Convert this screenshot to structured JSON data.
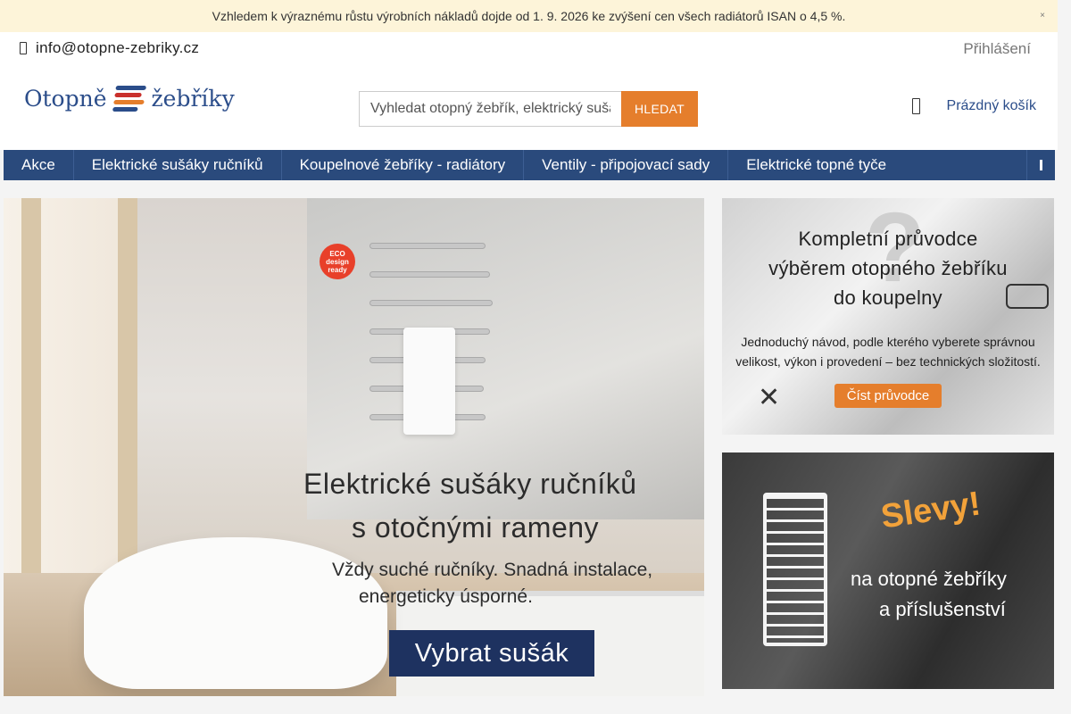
{
  "announcement": {
    "text": "Vzhledem k výraznému růstu výrobních nákladů dojde od 1. 9. 2026 ke zvýšení cen všech radiátorů ISAN o 4,5 %.",
    "close_icon": "×"
  },
  "topbar": {
    "email": "info@otopne-zebriky.cz",
    "login": "Přihlášení"
  },
  "header": {
    "logo_left": "Otopně",
    "logo_right": "žebříky",
    "search_placeholder": "Vyhledat otopný žebřík, elektrický sušák...",
    "search_button": "HLEDAT",
    "cart": "Prázdný košík"
  },
  "colors": {
    "accent": "#e57e2c",
    "nav_bg": "#2a4a7c",
    "brand_blue": "#2b4d8a"
  },
  "nav": {
    "items": [
      {
        "label": "Akce"
      },
      {
        "label": "Elektrické sušáky ručníků"
      },
      {
        "label": "Koupelnové žebříky - radiátory"
      },
      {
        "label": "Ventily - připojovací sady"
      },
      {
        "label": "Elektrické topné tyče"
      }
    ]
  },
  "hero": {
    "badge": "ECO design ready",
    "title_line1": "Elektrické sušáky ručníků",
    "title_line2": "s otočnými rameny",
    "text_line1": "Vždy suché ručníky. Snadná instalace,",
    "text_line2": "energeticky úsporné.",
    "cta": "Vybrat sušák"
  },
  "side_banner_guide": {
    "title_line1": "Kompletní průvodce",
    "title_line2": "výběrem otopného žebříku",
    "title_line3": "do koupelny",
    "text_line1": "Jednoduchý návod, podle kterého vyberete správnou",
    "text_line2": "velikost, výkon i provedení – bez technických složitostí.",
    "button": "Číst průvodce"
  },
  "side_banner_sale": {
    "headline": "Slevy!",
    "line1": "na otopné žebříky",
    "line2": "a příslušenství"
  }
}
